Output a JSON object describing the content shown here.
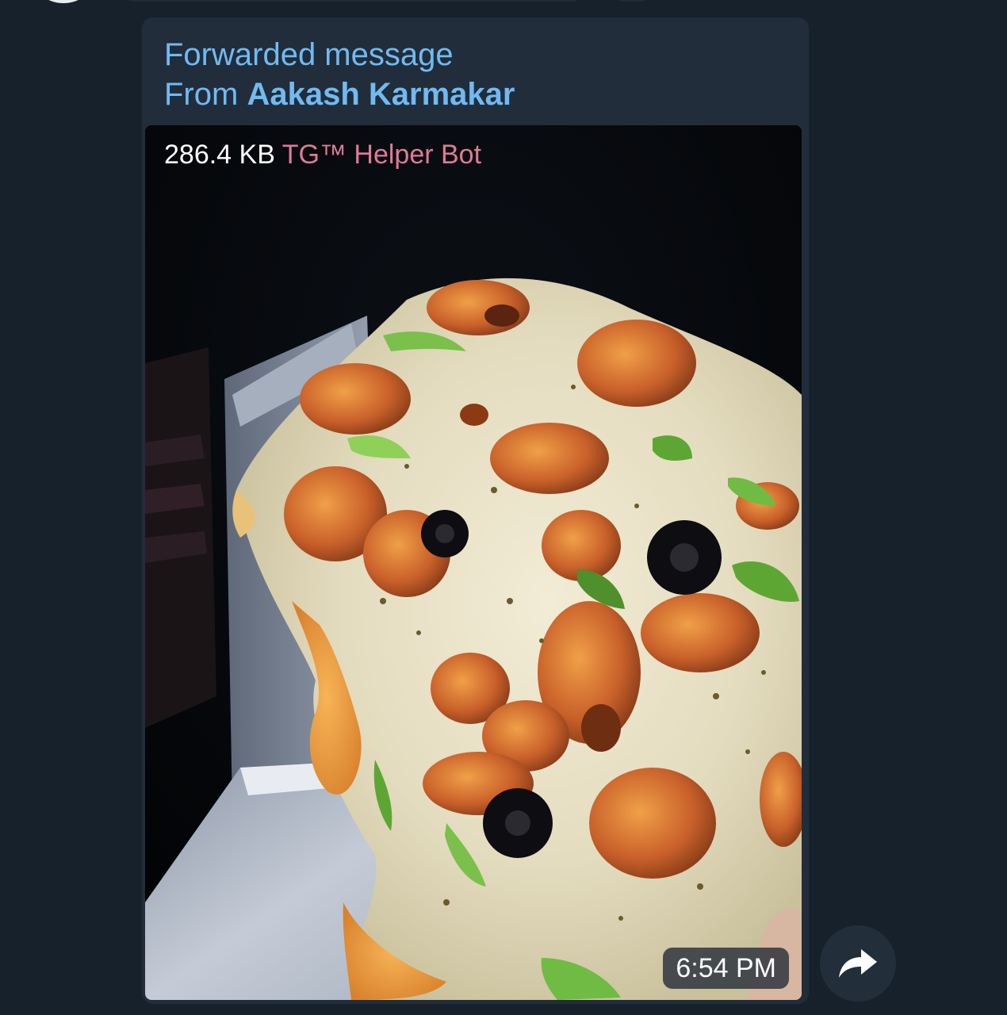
{
  "message": {
    "forward_label": "Forwarded message",
    "from_prefix": "From",
    "from_name": "Aakash Karmakar",
    "file_size": "286.4 KB",
    "via_bot": "TG™ Helper Bot",
    "time": "6:54 PM"
  },
  "icons": {
    "share": "share-arrow-icon"
  },
  "colors": {
    "background": "#17212b",
    "bubble": "#212d3b",
    "forward_text": "#71baf2",
    "bot_name": "#e07a96"
  }
}
